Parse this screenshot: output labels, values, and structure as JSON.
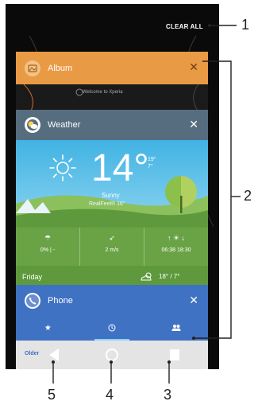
{
  "header": {
    "clear_all_label": "CLEAR ALL"
  },
  "cards": {
    "album": {
      "title": "Album",
      "icon": "album-icon",
      "color": "#e99a44",
      "peek_text": "Welcome to Xperia"
    },
    "weather": {
      "title": "Weather",
      "icon": "weather-icon",
      "temperature": "14°",
      "high": "19°",
      "low": "7°",
      "condition": "Sunny",
      "real_feel": "RealFeel® 16°",
      "stats": [
        {
          "icon": "umbrella-icon",
          "value": "0% | -"
        },
        {
          "icon": "wind-icon",
          "value": "2 m/s"
        },
        {
          "icon": "sunrise-sunset-icon",
          "value": "06:38  18:30"
        }
      ],
      "forecast": {
        "day": "Friday",
        "temps": "18° / 7°"
      }
    },
    "phone": {
      "title": "Phone",
      "icon": "phone-icon",
      "color": "#3f72c3"
    }
  },
  "navbar": {
    "older_label": "Older"
  },
  "callouts": {
    "c1": "1",
    "c2": "2",
    "c3": "3",
    "c4": "4",
    "c5": "5"
  }
}
